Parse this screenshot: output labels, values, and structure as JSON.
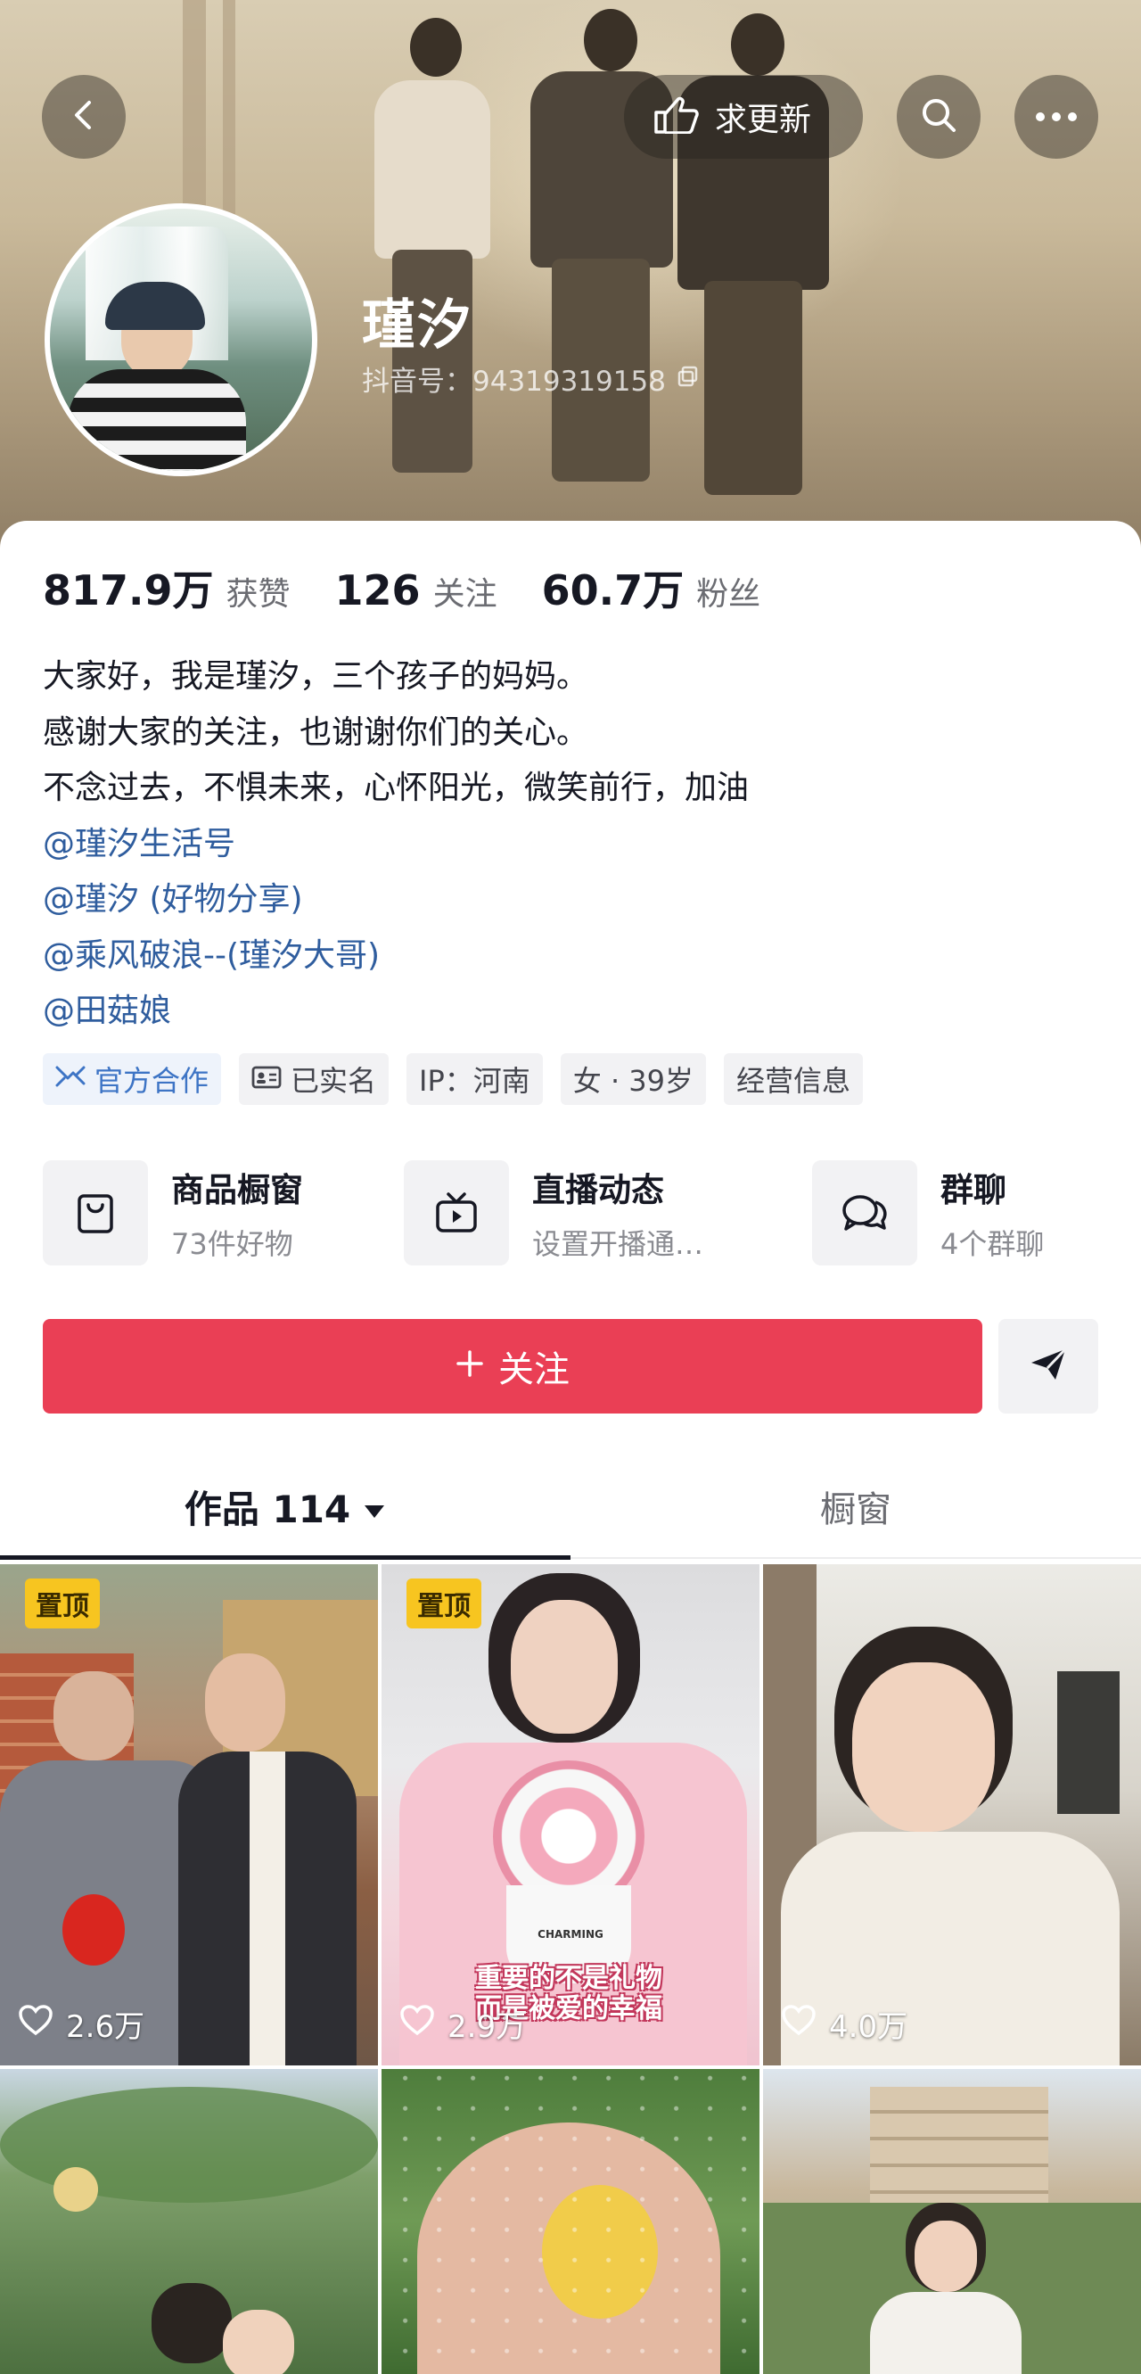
{
  "header": {
    "action_pill_label": "求更新",
    "icons": {
      "back": "back-arrow-icon",
      "pill": "pointing-hand-icon",
      "search": "search-icon",
      "more": "more-dots-icon"
    }
  },
  "profile": {
    "name": "瑾汐",
    "douyin_id": "抖音号：94319319158"
  },
  "stats": [
    {
      "num": "817.9万",
      "label": "获赞"
    },
    {
      "num": "126",
      "label": "关注"
    },
    {
      "num": "60.7万",
      "label": "粉丝"
    }
  ],
  "bio": {
    "lines": [
      "大家好，我是瑾汐，三个孩子的妈妈。",
      "感谢大家的关注，也谢谢你们的关心。",
      "不念过去，不惧未来，心怀阳光，微笑前行，加油"
    ],
    "mentions": [
      "@瑾汐生活号",
      "@瑾汐 (好物分享)",
      "@乘风破浪--(瑾汐大哥)",
      "@田菇娘"
    ]
  },
  "tags": [
    {
      "label": "官方合作",
      "icon": "cooperation-icon"
    },
    {
      "label": "已实名",
      "icon": "id-card-icon"
    },
    {
      "label": "IP：河南"
    },
    {
      "label": "女 · 39岁"
    },
    {
      "label": "经营信息"
    }
  ],
  "services": [
    {
      "title": "商品橱窗",
      "subtitle": "73件好物",
      "icon": "shopping-bag-icon"
    },
    {
      "title": "直播动态",
      "subtitle": "设置开播通…",
      "icon": "tv-live-icon"
    },
    {
      "title": "群聊",
      "subtitle": "4个群聊",
      "icon": "chat-bubbles-icon"
    }
  ],
  "follow_button": {
    "label": "关注",
    "icon": "plus-icon"
  },
  "share_icon": "send-icon",
  "tabs": {
    "works": "作品 114",
    "window": "橱窗"
  },
  "videos": [
    {
      "pinned": "置顶",
      "likes": "2.6万"
    },
    {
      "pinned": "置顶",
      "likes": "2.9万",
      "caption": "重要的不是礼物",
      "caption2": "而是被爱的幸福",
      "card_text": "CHARMING"
    },
    {
      "likes": "4.0万"
    },
    {},
    {},
    {}
  ],
  "colors": {
    "follow_red": "#ea3f55",
    "mention_blue": "#2f5d9e",
    "pin_yellow": "#f7c520"
  }
}
